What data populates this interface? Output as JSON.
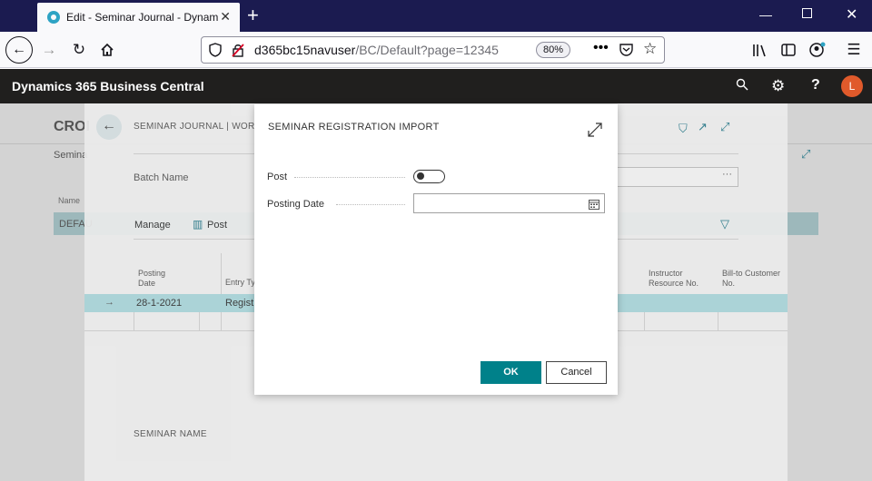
{
  "browser": {
    "tab_title": "Edit - Seminar Journal - Dynam",
    "url_main": "d365bc15navuser",
    "url_path": "/BC/Default?page=12345",
    "zoom": "80%"
  },
  "app": {
    "title": "Dynamics 365 Business Central",
    "avatar_initial": "L"
  },
  "background": {
    "left_title": "CROI",
    "left_sub": "Semina",
    "name_col": "Name",
    "defau_row": "DEFAU",
    "breadcrumb": "SEMINAR JOURNAL | WOR",
    "batch_name_label": "Batch Name",
    "manage_label": "Manage",
    "post_action": "Post",
    "col_posting_date": "Posting Date",
    "col_entry_type": "Entry Ty",
    "col_instructor": "Instructor Resource No.",
    "col_billto": "Bill-to Customer No.",
    "row_date": "28-1-2021",
    "row_entry": "Regist",
    "seminar_name_label": "SEMINAR NAME"
  },
  "dialog": {
    "title": "SEMINAR REGISTRATION IMPORT",
    "post_label": "Post",
    "post_value": false,
    "posting_date_label": "Posting Date",
    "posting_date_value": "",
    "ok_label": "OK",
    "cancel_label": "Cancel"
  },
  "colors": {
    "accent": "#00818a",
    "header_bg": "#201f1e",
    "avatar_bg": "#e05a2b"
  }
}
